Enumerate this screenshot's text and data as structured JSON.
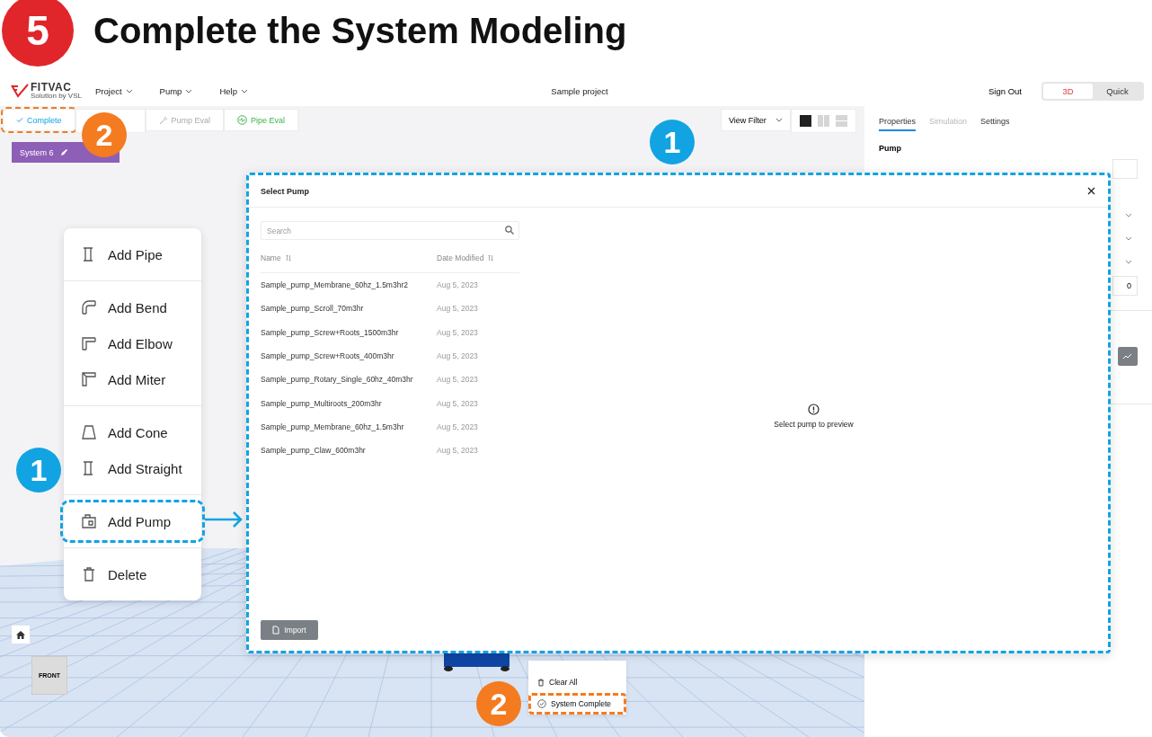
{
  "step": {
    "number": "5",
    "title": "Complete the System Modeling"
  },
  "logo": {
    "name": "FITVAC",
    "tagline": "Solution by VSL"
  },
  "menus": [
    {
      "label": "Project"
    },
    {
      "label": "Pump"
    },
    {
      "label": "Help"
    }
  ],
  "project_name": "Sample project",
  "sign_out": "Sign Out",
  "view_modes": [
    {
      "label": "3D",
      "selected": true
    },
    {
      "label": "Quick",
      "selected": false
    }
  ],
  "toolbar": [
    {
      "kind": "complete",
      "label": "Complete",
      "highlighted": true
    },
    {
      "kind": "pump",
      "label": "Pump Eval",
      "highlighted": false
    },
    {
      "kind": "pipe",
      "label": "Pipe Eval",
      "highlighted": false
    }
  ],
  "view_filter": "View Filter",
  "layouts": [
    {
      "kind": "single",
      "selected": true
    },
    {
      "kind": "columns",
      "selected": false
    },
    {
      "kind": "rows",
      "selected": false
    }
  ],
  "system": "System 6",
  "context_menu": [
    [
      {
        "kind": "pipe",
        "label": "Add Pipe",
        "highlighted": false
      }
    ],
    [
      {
        "kind": "bend",
        "label": "Add Bend",
        "highlighted": false
      },
      {
        "kind": "elbow",
        "label": "Add Elbow",
        "highlighted": false
      },
      {
        "kind": "miter",
        "label": "Add Miter",
        "highlighted": false
      }
    ],
    [
      {
        "kind": "cone",
        "label": "Add Cone",
        "highlighted": false
      },
      {
        "kind": "straight",
        "label": "Add Straight",
        "highlighted": false
      }
    ],
    [
      {
        "kind": "pump",
        "label": "Add Pump",
        "highlighted": true
      }
    ],
    [
      {
        "kind": "delete",
        "label": "Delete",
        "highlighted": false
      }
    ]
  ],
  "scene": {
    "front_label": "FRONT"
  },
  "bottom_menu": [
    {
      "kind": "clear",
      "label": "Clear All",
      "highlighted": false
    },
    {
      "kind": "complete",
      "label": "System Complete",
      "highlighted": true
    }
  ],
  "right_panel": {
    "tabs": [
      {
        "label": "Properties",
        "selected": true,
        "disabled": false
      },
      {
        "label": "Simulation",
        "selected": false,
        "disabled": true
      },
      {
        "label": "Settings",
        "selected": false,
        "disabled": false
      }
    ],
    "section": "Pump",
    "number_field": "0"
  },
  "modal": {
    "title": "Select Pump",
    "search_placeholder": "Search",
    "columns": [
      "Name",
      "Date Modified"
    ],
    "rows": [
      [
        "Sample_pump_Membrane_60hz_1.5m3hr2",
        "Aug 5, 2023"
      ],
      [
        "Sample_pump_Scroll_70m3hr",
        "Aug 5, 2023"
      ],
      [
        "Sample_pump_Screw+Roots_1500m3hr",
        "Aug 5, 2023"
      ],
      [
        "Sample_pump_Screw+Roots_400m3hr",
        "Aug 5, 2023"
      ],
      [
        "Sample_pump_Rotary_Single_60hz_40m3hr",
        "Aug 5, 2023"
      ],
      [
        "Sample_pump_Multiroots_200m3hr",
        "Aug 5, 2023"
      ],
      [
        "Sample_pump_Membrane_60hz_1.5m3hr",
        "Aug 5, 2023"
      ],
      [
        "Sample_pump_Claw_600m3hr",
        "Aug 5, 2023"
      ]
    ],
    "preview_message": "Select pump to preview",
    "import_button": "Import"
  },
  "markers": [
    {
      "label": "1",
      "color": "#12a3e3"
    },
    {
      "label": "2",
      "color": "#f47b20"
    },
    {
      "label": "1",
      "color": "#12a3e3"
    },
    {
      "label": "2",
      "color": "#f47b20"
    }
  ]
}
